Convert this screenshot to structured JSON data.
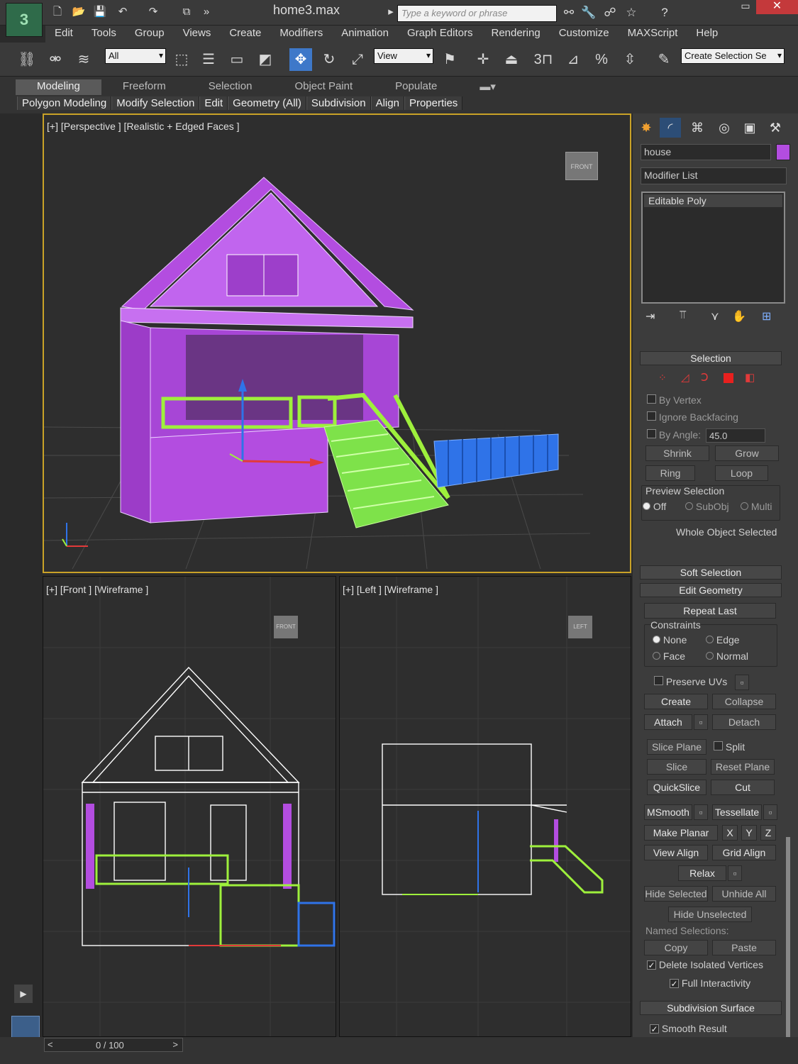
{
  "window": {
    "title": "home3.max",
    "search_placeholder": "Type a keyword or phrase",
    "close_glyph": "✕",
    "min_glyph": "▭"
  },
  "menu": [
    "Edit",
    "Tools",
    "Group",
    "Views",
    "Create",
    "Modifiers",
    "Animation",
    "Graph Editors",
    "Rendering",
    "Customize",
    "MAXScript",
    "Help"
  ],
  "toolbar": {
    "selection_filter": "All",
    "ref_coord": "View",
    "named_selection": "Create Selection Se",
    "snap_label": "3"
  },
  "ribbon": {
    "tabs": [
      "Modeling",
      "Freeform",
      "Selection",
      "Object Paint",
      "Populate"
    ],
    "active_tab": "Modeling",
    "panels": [
      "Polygon Modeling",
      "Modify Selection",
      "Edit",
      "Geometry (All)",
      "Subdivision",
      "Align",
      "Properties"
    ]
  },
  "viewports": {
    "perspective": "[+] [Perspective ] [Realistic + Edged Faces ]",
    "front": "[+] [Front ] [Wireframe ]",
    "left": "[+] [Left ] [Wireframe ]",
    "cube_front": "FRONT",
    "cube_left": "LEFT"
  },
  "command_panel": {
    "object_name": "house",
    "object_color": "#b34de0",
    "modifier_list": "Modifier List",
    "stack_item": "Editable Poly",
    "selection": {
      "title": "Selection",
      "by_vertex": "By Vertex",
      "ignore_backfacing": "Ignore Backfacing",
      "by_angle": "By Angle:",
      "angle_value": "45.0",
      "shrink": "Shrink",
      "grow": "Grow",
      "ring": "Ring",
      "loop": "Loop",
      "preview_selection": "Preview Selection",
      "off": "Off",
      "subobj": "SubObj",
      "multi": "Multi",
      "status": "Whole Object Selected"
    },
    "soft_selection": "Soft Selection",
    "edit_geometry": {
      "title": "Edit Geometry",
      "repeat_last": "Repeat Last",
      "constraints": "Constraints",
      "none": "None",
      "edge": "Edge",
      "face": "Face",
      "normal": "Normal",
      "preserve_uvs": "Preserve UVs",
      "create": "Create",
      "collapse": "Collapse",
      "attach": "Attach",
      "detach": "Detach",
      "slice_plane": "Slice Plane",
      "split": "Split",
      "slice": "Slice",
      "reset_plane": "Reset Plane",
      "quickslice": "QuickSlice",
      "cut": "Cut",
      "msmooth": "MSmooth",
      "tessellate": "Tessellate",
      "make_planar": "Make Planar",
      "x": "X",
      "y": "Y",
      "z": "Z",
      "view_align": "View Align",
      "grid_align": "Grid Align",
      "relax": "Relax",
      "hide_selected": "Hide Selected",
      "unhide_all": "Unhide All",
      "hide_unselected": "Hide Unselected",
      "named_selections": "Named Selections:",
      "copy": "Copy",
      "paste": "Paste",
      "delete_isolated": "Delete Isolated Vertices",
      "full_interactivity": "Full Interactivity"
    },
    "subdivision_surface": {
      "title": "Subdivision Surface",
      "smooth_result": "Smooth Result"
    }
  },
  "timeline": {
    "frame": "0 / 100"
  },
  "colors": {
    "house": "#b34de0",
    "railing": "#9ef03c",
    "fence": "#2f73e8",
    "viewport_active_border": "#c9a227"
  }
}
